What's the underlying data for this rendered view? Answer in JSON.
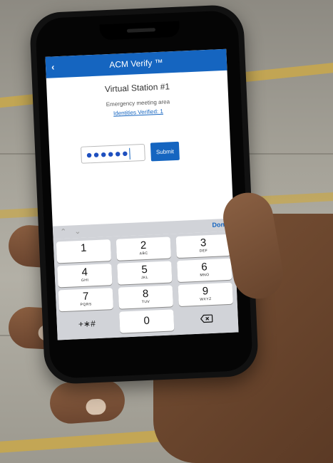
{
  "app": {
    "title": "ACM Verify ™",
    "back_icon": "chevron-left-icon",
    "station_name": "Virtual Station #1",
    "meeting_area": "Emergency meeting area",
    "identities_link": "Identities Verified: 1",
    "pin_value": "●●●●●●",
    "submit_label": "Submit"
  },
  "keyboard": {
    "done_label": "Done",
    "keys": [
      {
        "num": "1",
        "letters": ""
      },
      {
        "num": "2",
        "letters": "ABC"
      },
      {
        "num": "3",
        "letters": "DEF"
      },
      {
        "num": "4",
        "letters": "GHI"
      },
      {
        "num": "5",
        "letters": "JKL"
      },
      {
        "num": "6",
        "letters": "MNO"
      },
      {
        "num": "7",
        "letters": "PQRS"
      },
      {
        "num": "8",
        "letters": "TUV"
      },
      {
        "num": "9",
        "letters": "WXYZ"
      },
      {
        "num": "0",
        "letters": ""
      }
    ],
    "symbols_key": "+∗#",
    "delete_icon": "backspace-icon"
  },
  "colors": {
    "accent": "#1565c0"
  }
}
